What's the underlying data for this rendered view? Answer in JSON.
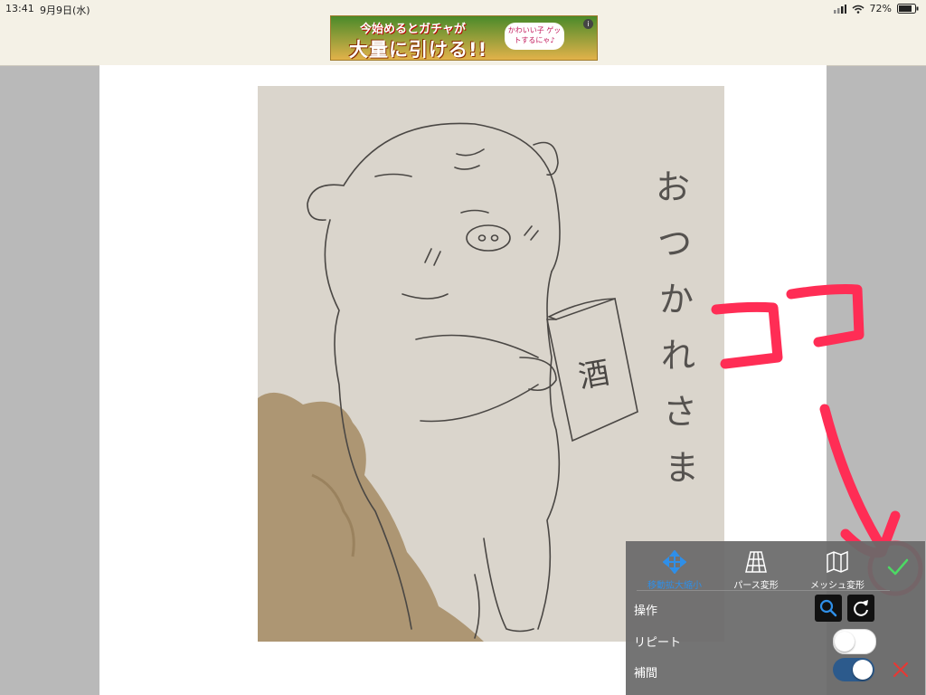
{
  "status": {
    "time": "13:41",
    "date": "9月9日(水)",
    "battery": "72%"
  },
  "ad": {
    "line1": "今始めるとガチャが",
    "line2": "大量に引ける!!",
    "bubble": "かわいい子 ゲットするにゃ♪"
  },
  "drawing": {
    "vertical_text": "おつかれさま",
    "can_label": "酒",
    "annotation": "ココ"
  },
  "toolbar": {
    "modes": [
      {
        "label": "移動拡大縮小",
        "icon": "move-arrows-icon",
        "active": true
      },
      {
        "label": "パース変形",
        "icon": "perspective-grid-icon",
        "active": false
      },
      {
        "label": "メッシュ変形",
        "icon": "mesh-map-icon",
        "active": false
      }
    ],
    "operation_label": "操作",
    "repeat_label": "リピート",
    "interpolation_label": "補間",
    "repeat_on": false,
    "interpolation_on": true
  },
  "colors": {
    "accent_blue": "#2f8fe8",
    "confirm_green": "#4cd964",
    "cancel_red": "#e53935",
    "annotation_red": "#ff2d55"
  }
}
